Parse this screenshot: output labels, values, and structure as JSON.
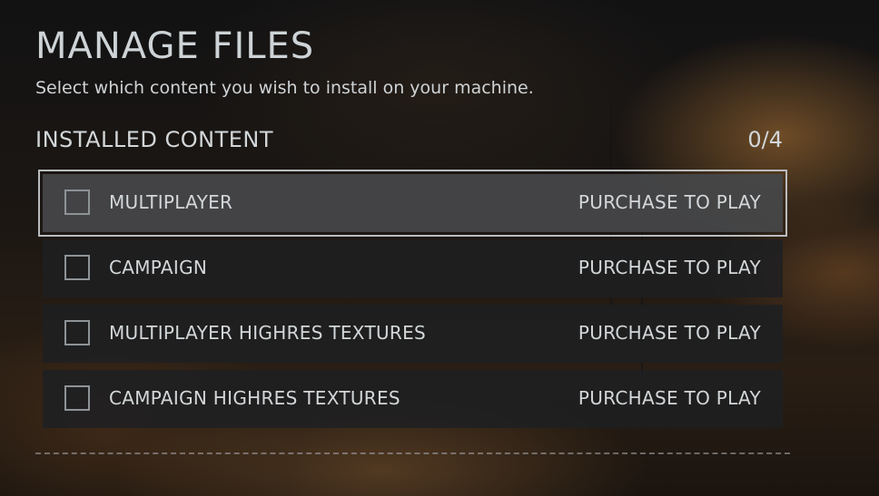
{
  "page": {
    "title": "MANAGE FILES",
    "subtitle": "Select which content you wish to install on your machine."
  },
  "section": {
    "title": "INSTALLED CONTENT",
    "count": "0/4"
  },
  "items": [
    {
      "label": "MULTIPLAYER",
      "status": "PURCHASE TO PLAY",
      "checked": false,
      "selected": true
    },
    {
      "label": "CAMPAIGN",
      "status": "PURCHASE TO PLAY",
      "checked": false,
      "selected": false
    },
    {
      "label": "MULTIPLAYER HIGHRES TEXTURES",
      "status": "PURCHASE TO PLAY",
      "checked": false,
      "selected": false
    },
    {
      "label": "CAMPAIGN HIGHRES TEXTURES",
      "status": "PURCHASE TO PLAY",
      "checked": false,
      "selected": false
    }
  ],
  "colors": {
    "text": "#d3d7d9",
    "row_background": "#1e2022",
    "selected_row_background": "#46484a",
    "selected_outline": "#b9bcbe"
  }
}
